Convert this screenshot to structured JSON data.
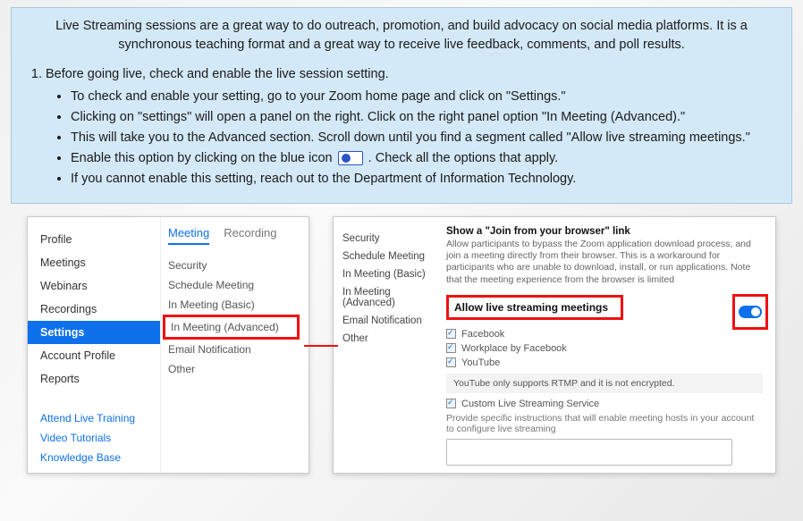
{
  "instructions": {
    "intro1": "Live Streaming sessions are a great way to do outreach, promotion, and build advocacy on social media platforms. It is a synchronous teaching format and a great way to receive live feedback, comments, and poll results.",
    "step1": "Before going live, check and enable the live session setting.",
    "bullets": [
      "To check and enable your setting, go to your Zoom home page and click on \"Settings.\"",
      "Clicking on \"settings\" will open a panel on the right. Click on the right panel option \"In Meeting (Advanced).\"",
      "This will take you to the Advanced section. Scroll down until you find a segment called \"Allow live streaming meetings.\"",
      "Enable this option by clicking on the blue icon",
      ". Check all the options that apply.",
      "If you cannot enable this setting, reach out to the Department of Information Technology."
    ]
  },
  "sidebar": {
    "items": [
      "Profile",
      "Meetings",
      "Webinars",
      "Recordings",
      "Settings",
      "Account Profile",
      "Reports"
    ],
    "active_index": 4,
    "links": [
      "Attend Live Training",
      "Video Tutorials",
      "Knowledge Base"
    ]
  },
  "subpanel": {
    "tabs": [
      "Meeting",
      "Recording"
    ],
    "active_tab": 0,
    "links": [
      "Security",
      "Schedule Meeting",
      "In Meeting (Basic)",
      "In Meeting (Advanced)",
      "Email Notification",
      "Other"
    ],
    "highlight_index": 3
  },
  "right": {
    "nav": [
      "Security",
      "Schedule Meeting",
      "In Meeting (Basic)",
      "In Meeting (Advanced)",
      "Email Notification",
      "Other"
    ],
    "browser_link_title": "Show a \"Join from your browser\" link",
    "browser_link_desc": "Allow participants to bypass the Zoom application download process, and join a meeting directly from their browser. This is a workaround for participants who are unable to download, install, or run applications. Note that the meeting experience from the browser is limited",
    "allow_title": "Allow live streaming meetings",
    "checks": [
      "Facebook",
      "Workplace by Facebook",
      "YouTube"
    ],
    "youtube_note": "YouTube only supports RTMP and it is not encrypted.",
    "custom_label": "Custom Live Streaming Service",
    "custom_desc": "Provide specific instructions that will enable meeting hosts in your account to configure live streaming"
  }
}
